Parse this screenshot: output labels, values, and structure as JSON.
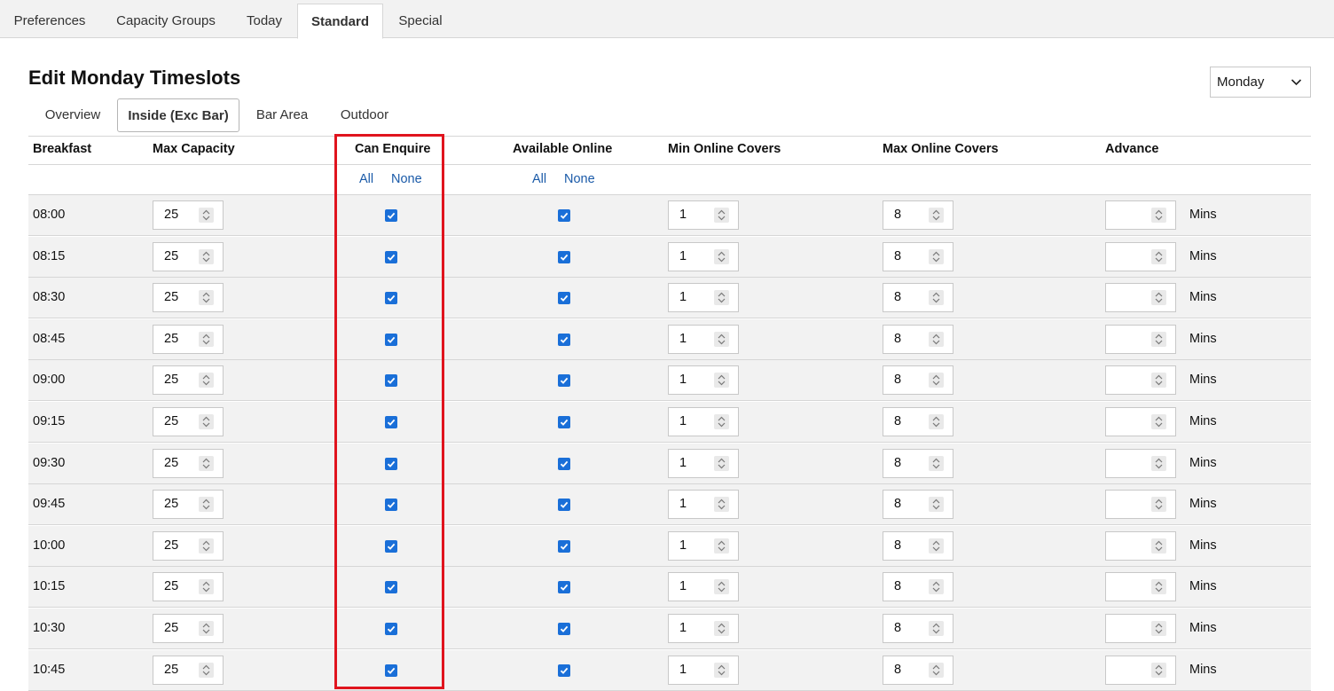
{
  "top_tabs": [
    "Preferences",
    "Capacity Groups",
    "Today",
    "Standard",
    "Special"
  ],
  "active_top_tab": "Standard",
  "page_title": "Edit Monday Timeslots",
  "day_select": {
    "value": "Monday"
  },
  "area_tabs": [
    "Overview",
    "Inside (Exc Bar)",
    "Bar Area",
    "Outdoor"
  ],
  "active_area_tab": "Inside (Exc Bar)",
  "columns": {
    "service": "Breakfast",
    "max_capacity": "Max Capacity",
    "can_enquire": "Can Enquire",
    "available_online": "Available Online",
    "min_online_covers": "Min Online Covers",
    "max_online_covers": "Max Online Covers",
    "advance": "Advance"
  },
  "bulk_links": {
    "all": "All",
    "none": "None"
  },
  "mins_label": "Mins",
  "rows": [
    {
      "time": "08:00",
      "max_capacity": "25",
      "can_enquire": true,
      "available_online": true,
      "min_online_covers": "1",
      "max_online_covers": "8",
      "advance": ""
    },
    {
      "time": "08:15",
      "max_capacity": "25",
      "can_enquire": true,
      "available_online": true,
      "min_online_covers": "1",
      "max_online_covers": "8",
      "advance": ""
    },
    {
      "time": "08:30",
      "max_capacity": "25",
      "can_enquire": true,
      "available_online": true,
      "min_online_covers": "1",
      "max_online_covers": "8",
      "advance": ""
    },
    {
      "time": "08:45",
      "max_capacity": "25",
      "can_enquire": true,
      "available_online": true,
      "min_online_covers": "1",
      "max_online_covers": "8",
      "advance": ""
    },
    {
      "time": "09:00",
      "max_capacity": "25",
      "can_enquire": true,
      "available_online": true,
      "min_online_covers": "1",
      "max_online_covers": "8",
      "advance": ""
    },
    {
      "time": "09:15",
      "max_capacity": "25",
      "can_enquire": true,
      "available_online": true,
      "min_online_covers": "1",
      "max_online_covers": "8",
      "advance": ""
    },
    {
      "time": "09:30",
      "max_capacity": "25",
      "can_enquire": true,
      "available_online": true,
      "min_online_covers": "1",
      "max_online_covers": "8",
      "advance": ""
    },
    {
      "time": "09:45",
      "max_capacity": "25",
      "can_enquire": true,
      "available_online": true,
      "min_online_covers": "1",
      "max_online_covers": "8",
      "advance": ""
    },
    {
      "time": "10:00",
      "max_capacity": "25",
      "can_enquire": true,
      "available_online": true,
      "min_online_covers": "1",
      "max_online_covers": "8",
      "advance": ""
    },
    {
      "time": "10:15",
      "max_capacity": "25",
      "can_enquire": true,
      "available_online": true,
      "min_online_covers": "1",
      "max_online_covers": "8",
      "advance": ""
    },
    {
      "time": "10:30",
      "max_capacity": "25",
      "can_enquire": true,
      "available_online": true,
      "min_online_covers": "1",
      "max_online_covers": "8",
      "advance": ""
    },
    {
      "time": "10:45",
      "max_capacity": "25",
      "can_enquire": true,
      "available_online": true,
      "min_online_covers": "1",
      "max_online_covers": "8",
      "advance": ""
    }
  ],
  "colors": {
    "highlight": "#e0141e",
    "link": "#1a5aa8",
    "checkbox": "#1a6fd8",
    "row_bg": "#f2f2f2"
  }
}
